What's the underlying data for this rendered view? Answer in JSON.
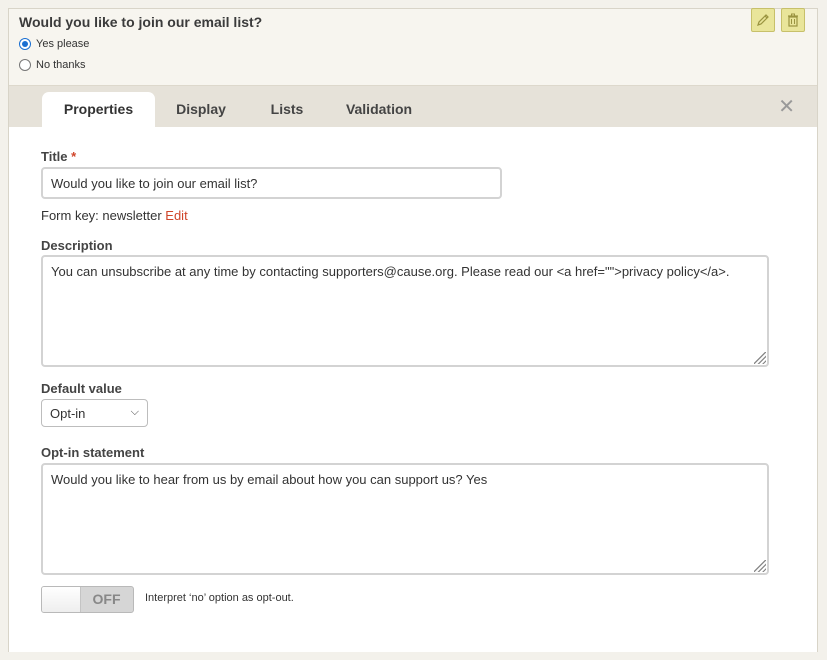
{
  "preview": {
    "question": "Would you like to join our email list?",
    "options": [
      {
        "label": "Yes please",
        "selected": true
      },
      {
        "label": "No thanks",
        "selected": false
      }
    ],
    "edit_icon": "pencil-icon",
    "delete_icon": "trash-icon"
  },
  "tabs": [
    {
      "label": "Properties",
      "active": true
    },
    {
      "label": "Display",
      "active": false
    },
    {
      "label": "Lists",
      "active": false
    },
    {
      "label": "Validation",
      "active": false
    }
  ],
  "form": {
    "title_label": "Title",
    "required_mark": "*",
    "title_value": "Would you like to join our email list?",
    "form_key_text": "Form key: newsletter",
    "form_key_edit": "Edit",
    "description_label": "Description",
    "description_value": "You can unsubscribe at any time by contacting supporters@cause.org. Please read our <a href=\"\">privacy policy</a>.",
    "default_value_label": "Default value",
    "default_value": "Opt-in",
    "optin_label": "Opt-in statement",
    "optin_value": "Would you like to hear from us by email about how you can support us? Yes",
    "toggle_state": "OFF",
    "toggle_desc": "Interpret ‘no’ option as opt-out."
  },
  "colors": {
    "accent_link": "#d0452a",
    "tool_button": "#e9e59a",
    "radio_selected": "#1a6fd1"
  }
}
